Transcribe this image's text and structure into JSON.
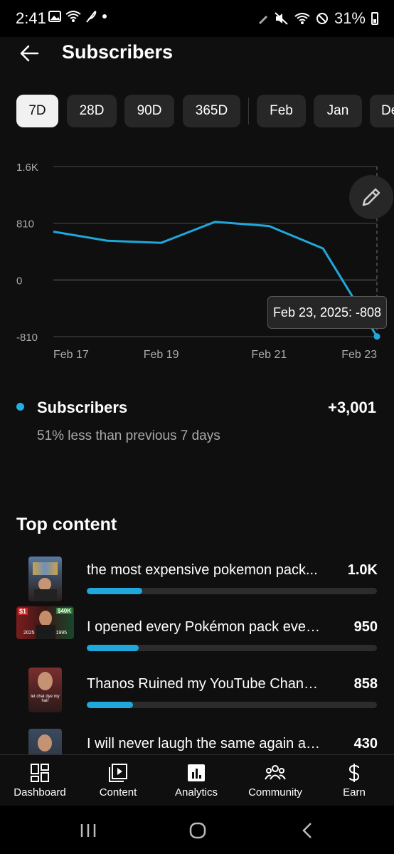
{
  "status": {
    "time": "2:41",
    "battery": "31%"
  },
  "header": {
    "title": "Subscribers"
  },
  "chips": [
    "7D",
    "28D",
    "90D",
    "365D",
    "Feb",
    "Jan",
    "De"
  ],
  "chart_data": {
    "type": "line",
    "x": [
      "Feb 17",
      "Feb 18",
      "Feb 19",
      "Feb 20",
      "Feb 21",
      "Feb 22",
      "Feb 23"
    ],
    "y": [
      690,
      560,
      530,
      830,
      770,
      450,
      -808
    ],
    "y_ticks": [
      "1.6K",
      "810",
      "0",
      "-810"
    ],
    "x_ticks": [
      "Feb 17",
      "Feb 19",
      "Feb 21",
      "Feb 23"
    ],
    "ylim": [
      -810,
      1620
    ],
    "grid": true,
    "line_color": "#1fa8db",
    "tooltip": "Feb 23, 2025: -808"
  },
  "metric": {
    "name": "Subscribers",
    "value": "+3,001",
    "comparison": "51% less than previous 7 days"
  },
  "top_content": {
    "title": "Top content",
    "items": [
      {
        "title": "the most expensive pokemon pack...",
        "value": "1.0K",
        "share": 0.19
      },
      {
        "title": "I opened every Pokémon pack ever...",
        "value": "950",
        "share": 0.18
      },
      {
        "title": "Thanos Ruined my YouTube Channel",
        "value": "858",
        "share": 0.16
      },
      {
        "title": "I will never laugh the same again af...",
        "value": "430",
        "share": 0.08
      }
    ]
  },
  "thumb_text": {
    "t2_price_left": "$1",
    "t2_price_right": "$40K",
    "t2_year_left": "2025",
    "t2_year_right": "1995",
    "t3_caption": "let chat dye my hair"
  },
  "nav": [
    "Dashboard",
    "Content",
    "Analytics",
    "Community",
    "Earn"
  ],
  "accent": "#1fa8db"
}
